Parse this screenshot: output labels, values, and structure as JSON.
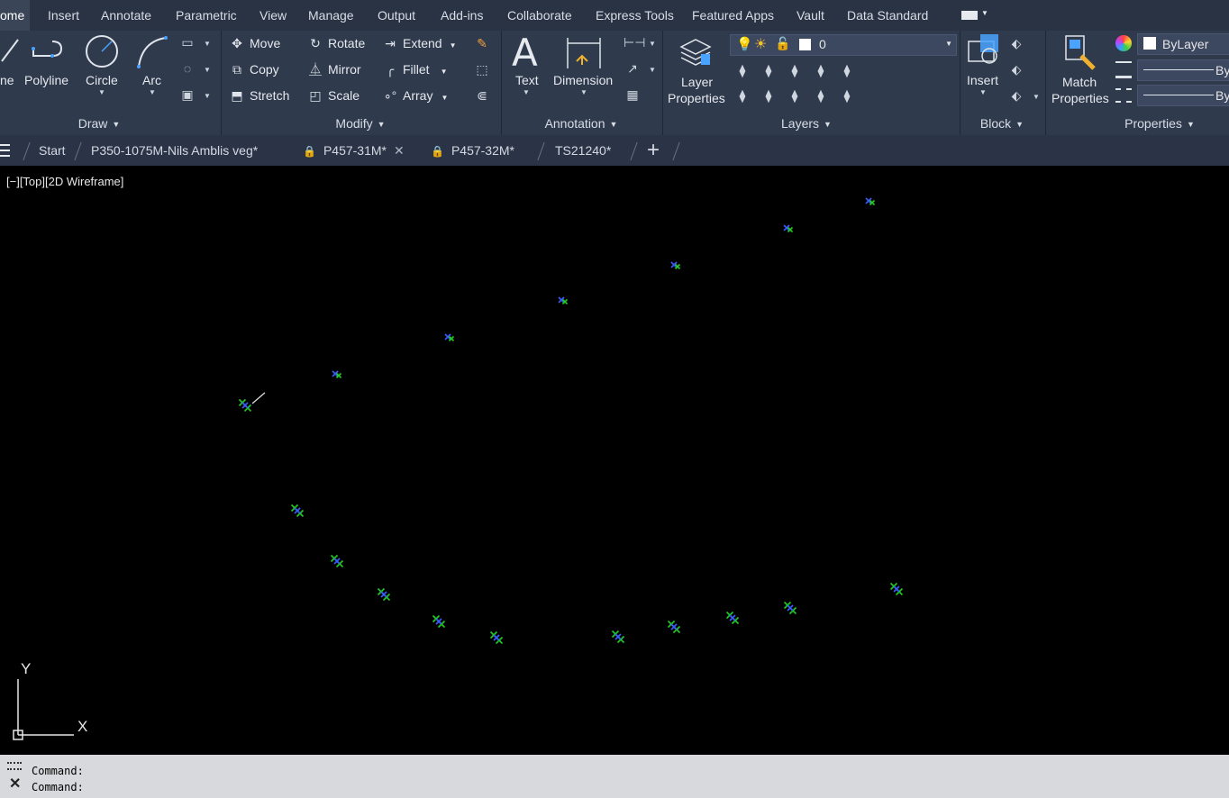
{
  "menubar": {
    "tabs": [
      "ome",
      "Insert",
      "Annotate",
      "Parametric",
      "View",
      "Manage",
      "Output",
      "Add-ins",
      "Collaborate",
      "Express Tools",
      "Featured Apps",
      "Vault",
      "Data Standard"
    ]
  },
  "ribbon": {
    "draw": {
      "title": "Draw",
      "line_label": "ne",
      "polyline_label": "Polyline",
      "circle_label": "Circle",
      "arc_label": "Arc"
    },
    "modify": {
      "title": "Modify",
      "move": "Move",
      "rotate": "Rotate",
      "extend": "Extend",
      "copy": "Copy",
      "mirror": "Mirror",
      "fillet": "Fillet",
      "stretch": "Stretch",
      "scale": "Scale",
      "array": "Array"
    },
    "annotation": {
      "title": "Annotation",
      "text_label": "Text",
      "dimension_label": "Dimension"
    },
    "layers": {
      "title": "Layers",
      "layer_properties_line1": "Layer",
      "layer_properties_line2": "Properties",
      "current_layer": "0"
    },
    "block": {
      "title": "Block",
      "insert_label": "Insert"
    },
    "properties": {
      "title": "Properties",
      "match_line1": "Match",
      "match_line2": "Properties",
      "color_value": "ByLayer",
      "linetype_value": "By",
      "lineweight_value": "By"
    }
  },
  "filetabs": {
    "start": "Start",
    "tab1": "P350-1075M-Nils Amblis veg*",
    "tab2": "P457-31M*",
    "tab3": "P457-32M*",
    "tab4": "TS21240*",
    "new_tab": "+"
  },
  "viewport": {
    "label": "[−][Top][2D Wireframe]",
    "ucs_x": "X",
    "ucs_y": "Y",
    "background": "#000000",
    "marker_blue": "#3b5bff",
    "marker_green": "#22cc22"
  },
  "command": {
    "line1": "Command:",
    "line2": "Command:"
  }
}
